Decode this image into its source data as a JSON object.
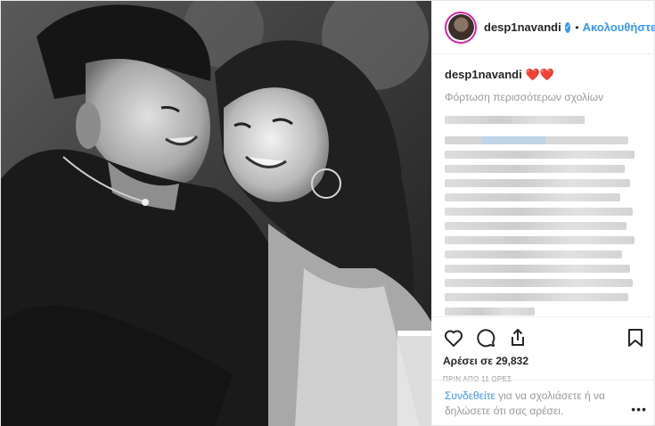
{
  "post": {
    "image_alt": "Black and white photo of a smiling couple",
    "header": {
      "username": "desp1navandi",
      "verified_icon": "verified-badge-icon",
      "separator": "•",
      "follow_label": "Ακολουθήστε"
    },
    "caption": {
      "username": "desp1navandi",
      "text": "❤️❤️"
    },
    "load_more_label": "Φόρτωση περισσότερων σχολίων",
    "actions": {
      "like_icon": "heart-icon",
      "comment_icon": "comment-bubble-icon",
      "share_icon": "share-icon",
      "save_icon": "bookmark-icon"
    },
    "likes_prefix": "Αρέσει σε",
    "likes_count": "29,832",
    "timestamp": "ΠΡΙΝ ΑΠΟ 11 ΩΡΕΣ",
    "login_prompt": {
      "link": "Συνδεθείτε",
      "text": " για να σχολιάσετε ή να δηλώσετε ότι σας αρέσει."
    },
    "more_label": "•••"
  },
  "colors": {
    "link_blue": "#3897f0",
    "heart_red": "#cc1f2e",
    "muted": "#999999"
  }
}
